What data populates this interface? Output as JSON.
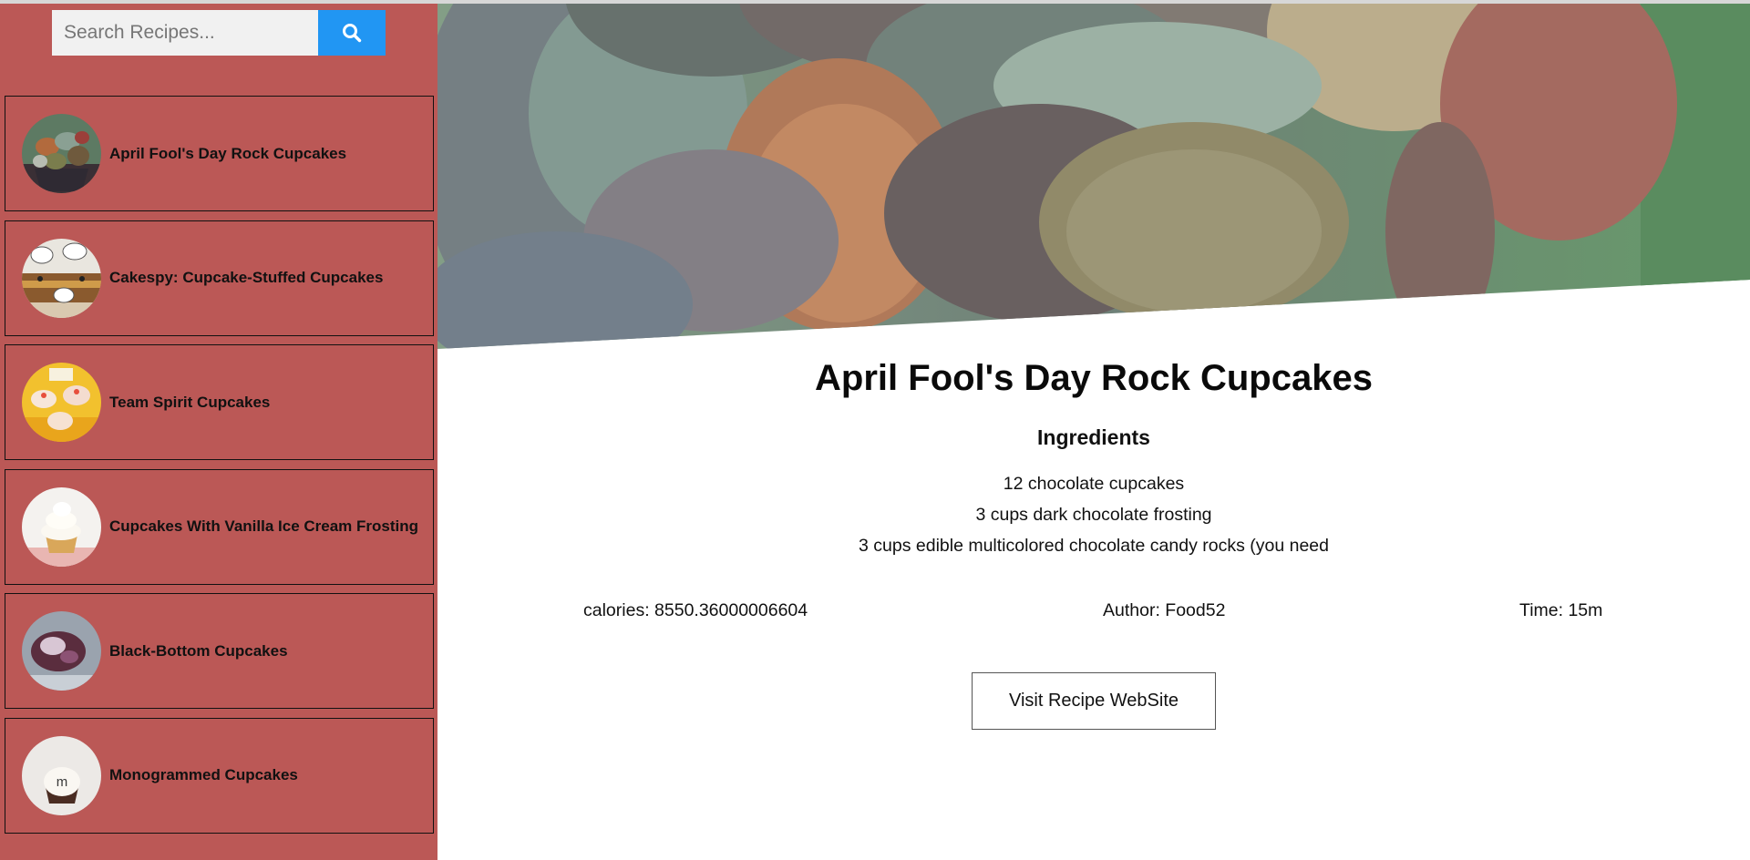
{
  "search": {
    "placeholder": "Search Recipes..."
  },
  "icons": {
    "search": "search-icon"
  },
  "sidebar": {
    "recipes": [
      {
        "title": "April Fool's Day Rock Cupcakes"
      },
      {
        "title": "Cakespy: Cupcake-Stuffed Cupcakes"
      },
      {
        "title": "Team Spirit Cupcakes"
      },
      {
        "title": "Cupcakes With Vanilla Ice Cream Frosting"
      },
      {
        "title": "Black-Bottom Cupcakes"
      },
      {
        "title": "Monogrammed Cupcakes"
      }
    ]
  },
  "recipe": {
    "title": "April Fool's Day Rock Cupcakes",
    "ingredients_heading": "Ingredients",
    "ingredients": [
      "12 chocolate cupcakes",
      "3 cups dark chocolate frosting",
      "3 cups edible multicolored chocolate candy rocks (you need"
    ],
    "calories": "calories: 8550.36000006604",
    "author": "Author: Food52",
    "time": "Time: 15m",
    "visit_label": "Visit Recipe WebSite"
  },
  "colors": {
    "sidebar_bg": "#bb5856",
    "search_button": "#2196f3"
  }
}
